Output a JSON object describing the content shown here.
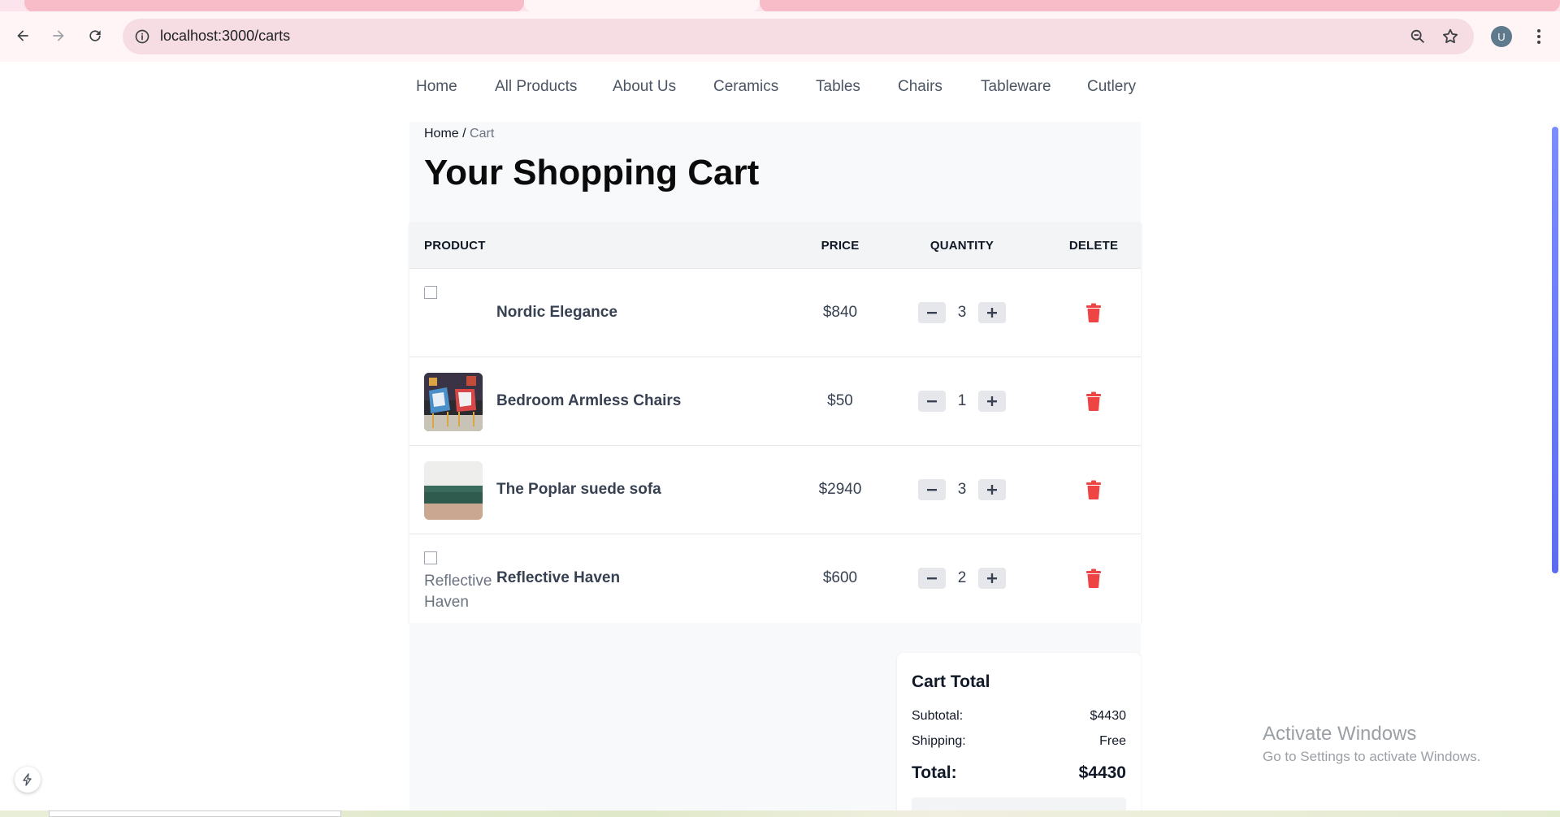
{
  "browser": {
    "url": "localhost:3000/carts",
    "profile_initial": "U"
  },
  "nav": {
    "items": [
      "Home",
      "All Products",
      "About Us",
      "Ceramics",
      "Tables",
      "Chairs",
      "Tableware",
      "Cutlery"
    ]
  },
  "breadcrumb": {
    "home": "Home",
    "separator": "/",
    "current": "Cart"
  },
  "page_title": "Your Shopping Cart",
  "table": {
    "headers": {
      "product": "PRODUCT",
      "price": "PRICE",
      "quantity": "QUANTITY",
      "delete": "DELETE"
    },
    "rows": [
      {
        "name": "Nordic Elegance",
        "price": "$840",
        "qty": "3",
        "image": "broken",
        "alt": ""
      },
      {
        "name": "Bedroom Armless Chairs",
        "price": "$50",
        "qty": "1",
        "image": "chairs-photo",
        "alt": ""
      },
      {
        "name": "The Poplar suede sofa",
        "price": "$2940",
        "qty": "3",
        "image": "sofa-photo",
        "alt": ""
      },
      {
        "name": "Reflective Haven",
        "price": "$600",
        "qty": "2",
        "image": "broken",
        "alt": "Reflective Haven"
      }
    ]
  },
  "cart_total": {
    "title": "Cart Total",
    "subtotal_label": "Subtotal:",
    "subtotal_value": "$4430",
    "shipping_label": "Shipping:",
    "shipping_value": "Free",
    "total_label": "Total:",
    "total_value": "$4430"
  },
  "watermark": {
    "line1": "Activate Windows",
    "line2": "Go to Settings to activate Windows."
  },
  "colors": {
    "delete_red": "#ef4444",
    "scroll_thumb": "#6b7cf5",
    "chrome_bg": "#fff5f7"
  }
}
